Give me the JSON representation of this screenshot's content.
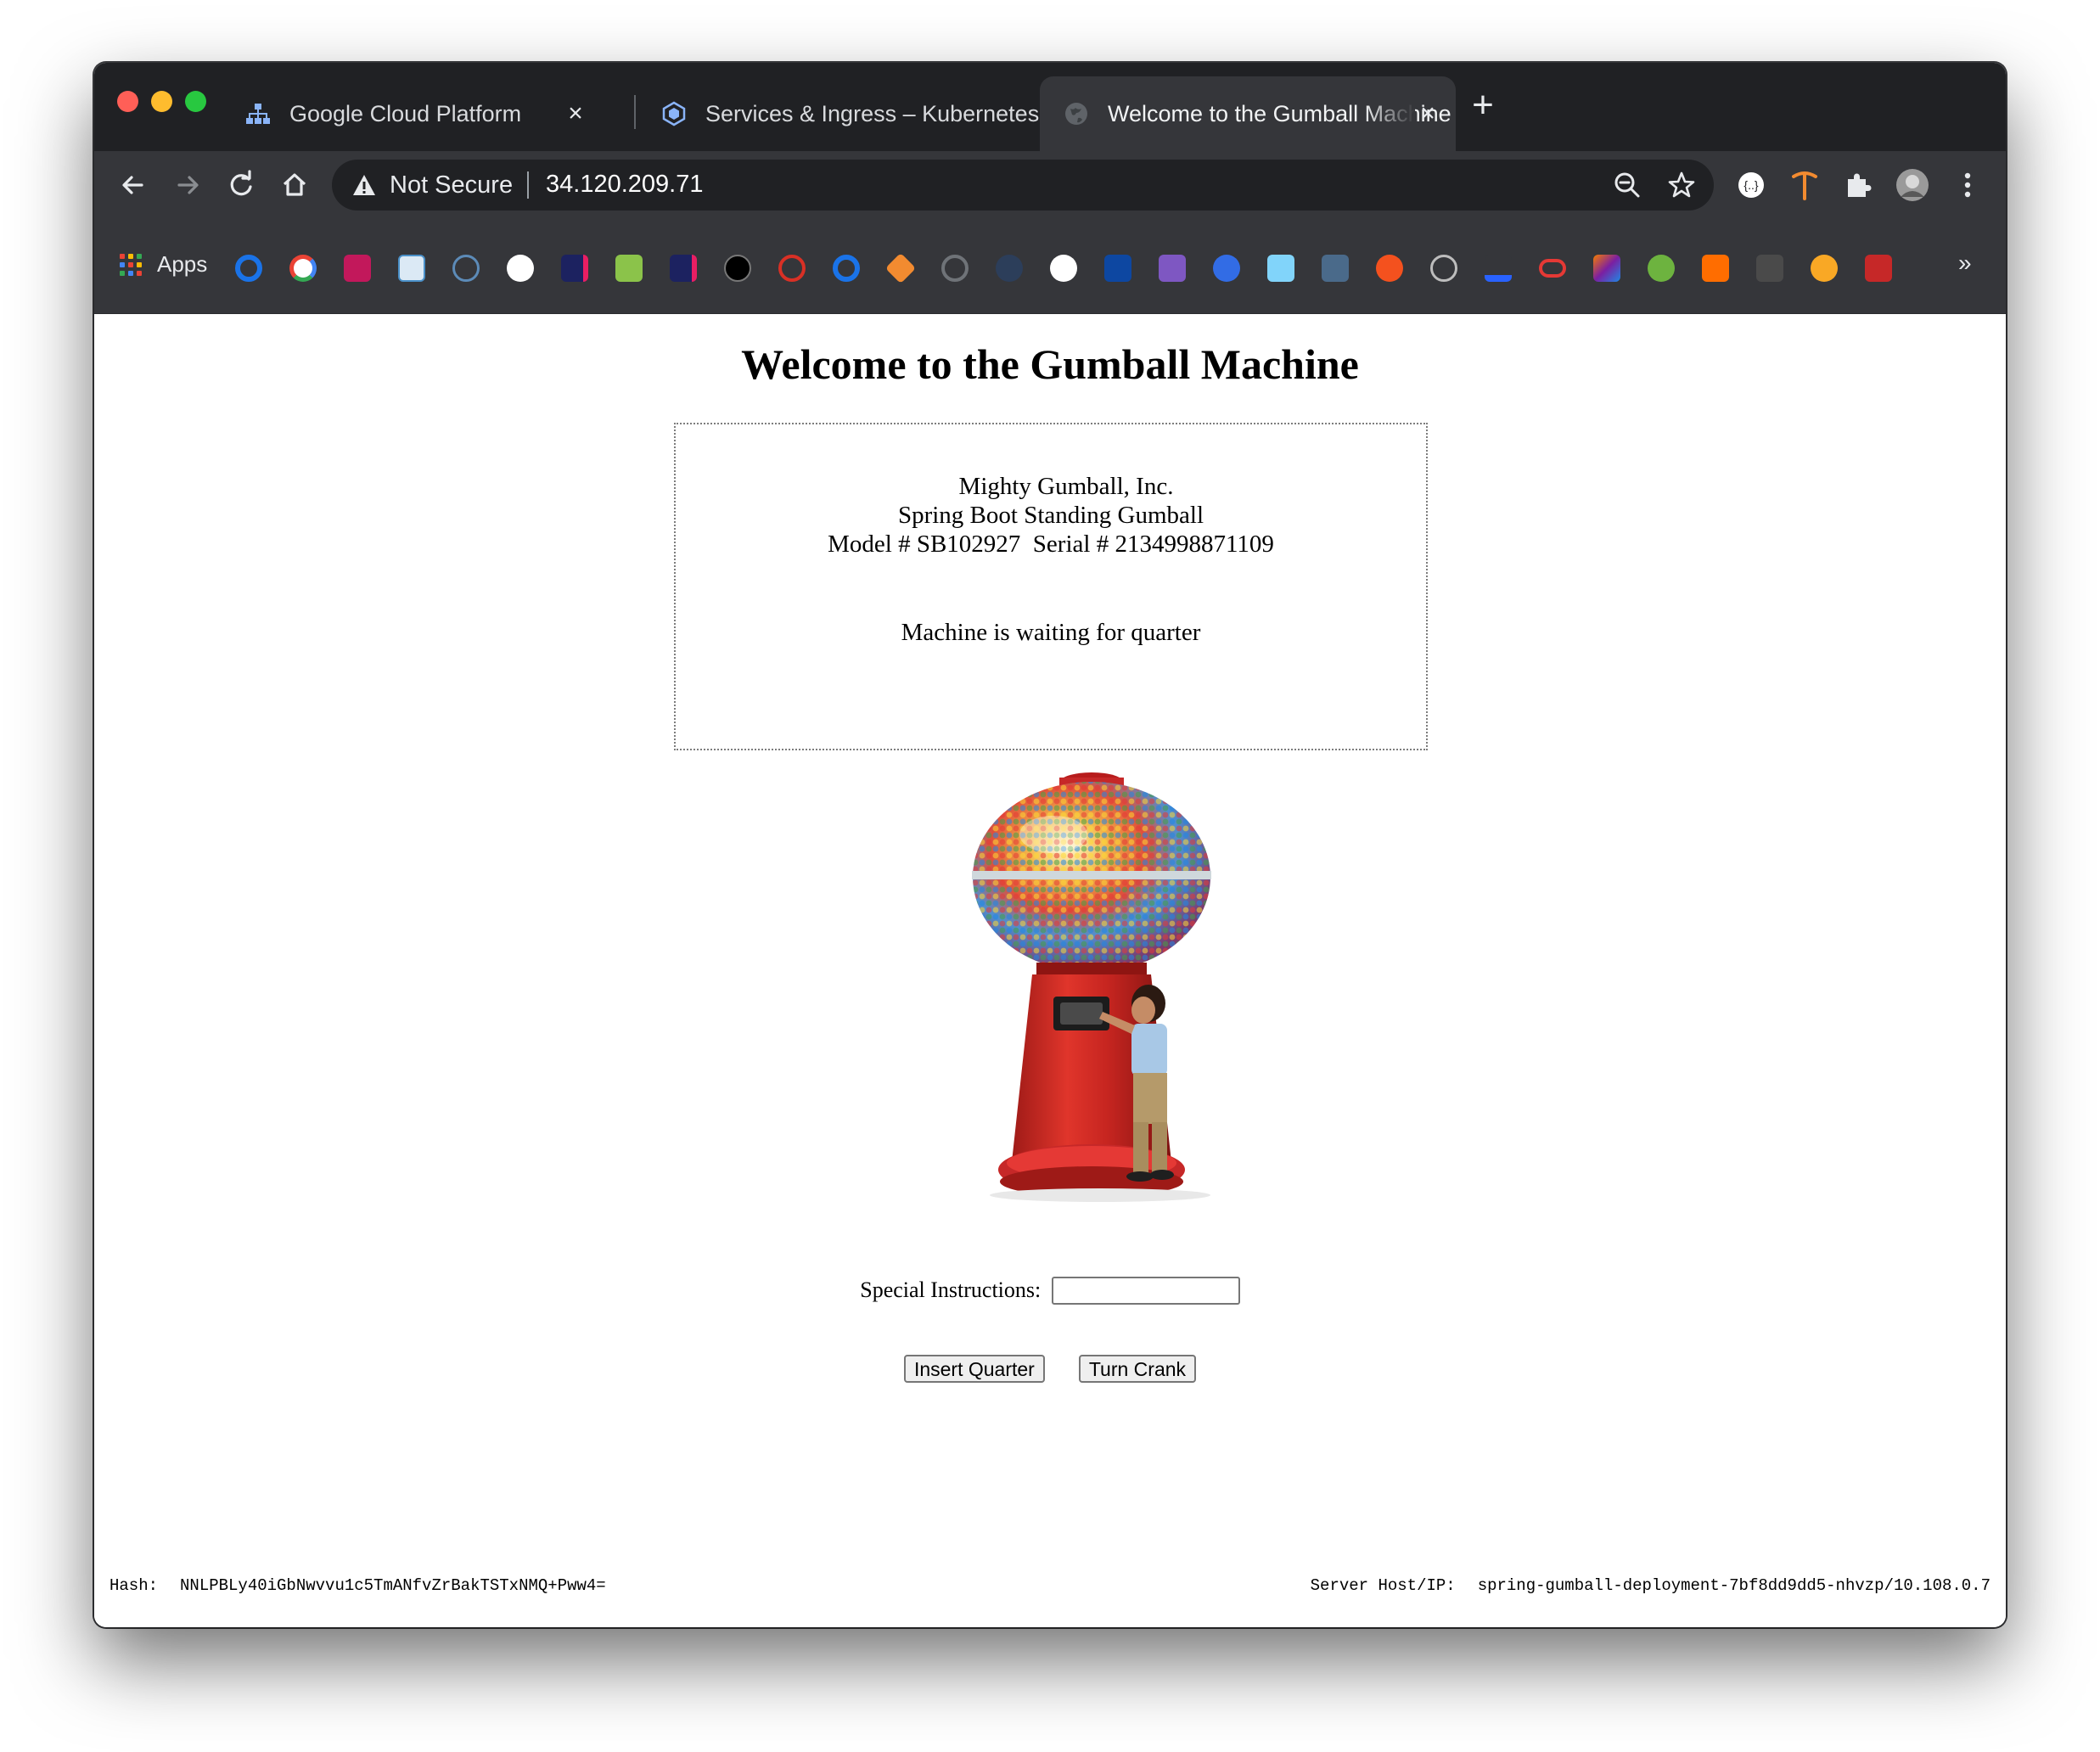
{
  "browser": {
    "tabs": [
      {
        "title": "Google Cloud Platform",
        "favicon": "gcp-sitemap-icon",
        "active": false
      },
      {
        "title": "Services & Ingress – Kubernetes",
        "favicon": "kubernetes-engine-icon",
        "active": false
      },
      {
        "title": "Welcome to the Gumball Machine",
        "favicon": "globe-icon",
        "active": true
      }
    ],
    "omnibox": {
      "security_label": "Not Secure",
      "url": "34.120.209.71"
    },
    "bookmarks": {
      "apps_label": "Apps",
      "more": "»"
    }
  },
  "page": {
    "title": "Welcome to the Gumball Machine",
    "company": "Mighty Gumball, Inc.",
    "product": "Spring Boot Standing Gumball",
    "model_serial": "Model # SB102927  Serial # 2134998871109",
    "status": "Machine is waiting for quarter",
    "instructions_label": "Special Instructions:",
    "instructions_value": "",
    "insert_quarter": "Insert Quarter",
    "turn_crank": "Turn Crank",
    "hash_label": "Hash:",
    "hash_value": "NNLPBLy40iGbNwvvu1c5TmANfvZrBakTSTxNMQ+Pww4=",
    "server_label": "Server Host/IP:",
    "server_value": "spring-gumball-deployment-7bf8dd9dd5-nhvzp/10.108.0.7"
  }
}
